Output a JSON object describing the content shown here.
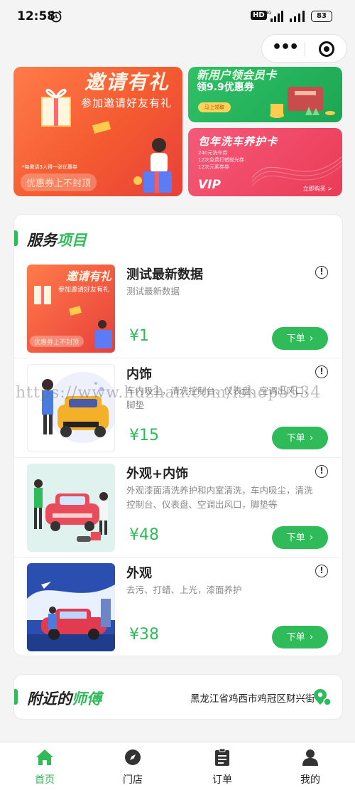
{
  "status_bar": {
    "time": "12:58",
    "hd": "HD",
    "network": "4G",
    "battery": "83"
  },
  "banners": {
    "left": {
      "title": "邀请有礼",
      "subtitle": "参加邀请好友有礼",
      "note": "*每邀请3人得一张优惠券",
      "tag": "优惠券上不封顶"
    },
    "top_right": {
      "title": "新用户领会员卡",
      "subtitle": "领9.9优惠券",
      "button": "马上领取"
    },
    "bottom_right": {
      "title": "包年洗车养护卡",
      "lines": [
        "240元洗车券",
        "12次免费打蜡抛光券",
        "12次元素券券"
      ],
      "vip": "VIP",
      "buy": "立即购买 >"
    }
  },
  "services": {
    "title_dark": "服务",
    "title_green": "项目",
    "items": [
      {
        "name": "测试最新数据",
        "desc": "测试最新数据",
        "price": "¥1",
        "button": "下单"
      },
      {
        "name": "内饰",
        "desc": "车内吸尘，清洗控制台、仪表盘、空调出风口，脚垫",
        "price": "¥15",
        "button": "下单"
      },
      {
        "name": "外观+内饰",
        "desc": "外观漆面清洗养护和内室清洗，车内吸尘，清洗控制台、仪表盘、空调出风口，脚垫等",
        "price": "¥48",
        "button": "下单"
      },
      {
        "name": "外观",
        "desc": "去污、打蜡、上光，漆面养护",
        "price": "¥38",
        "button": "下单"
      }
    ]
  },
  "nearby": {
    "title_dark": "附近的",
    "title_green": "师傅",
    "address": "黑龙江省鸡西市鸡冠区财兴街"
  },
  "watermark": "https://www.huzhan.com/ishop5534",
  "tabbar": [
    {
      "label": "首页",
      "icon": "home-icon",
      "active": true
    },
    {
      "label": "门店",
      "icon": "compass-icon",
      "active": false
    },
    {
      "label": "订单",
      "icon": "clipboard-icon",
      "active": false
    },
    {
      "label": "我的",
      "icon": "user-icon",
      "active": false
    }
  ],
  "colors": {
    "accent": "#2fbb5a",
    "banner_orange": "#f45a30",
    "banner_green": "#1da653",
    "banner_pink": "#ea3b56"
  }
}
